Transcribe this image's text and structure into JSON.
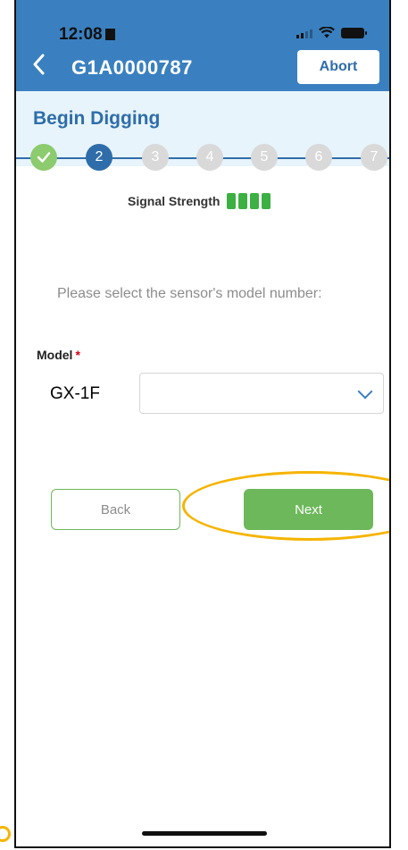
{
  "status_bar": {
    "time": "12:08"
  },
  "header": {
    "back_icon": "chevron-left-icon",
    "title": "G1A0000787",
    "abort_label": "Abort"
  },
  "stepper": {
    "heading": "Begin Digging",
    "steps": [
      "✓",
      "2",
      "3",
      "4",
      "5",
      "6",
      "7"
    ],
    "current_step": 2
  },
  "signal": {
    "label": "Signal Strength",
    "bars": 4,
    "color": "#3CB043"
  },
  "form": {
    "prompt": "Please select the sensor's model number:",
    "model_label": "Model",
    "required_marker": "*",
    "model_value": "GX-1F"
  },
  "actions": {
    "back_label": "Back",
    "next_label": "Next"
  },
  "colors": {
    "header": "#3A80C0",
    "accent": "#2F6DAA",
    "step_done": "#8CCB6E",
    "step_pending": "#D9D9D9",
    "button_green": "#6CB85A",
    "highlight": "#F5B400"
  }
}
